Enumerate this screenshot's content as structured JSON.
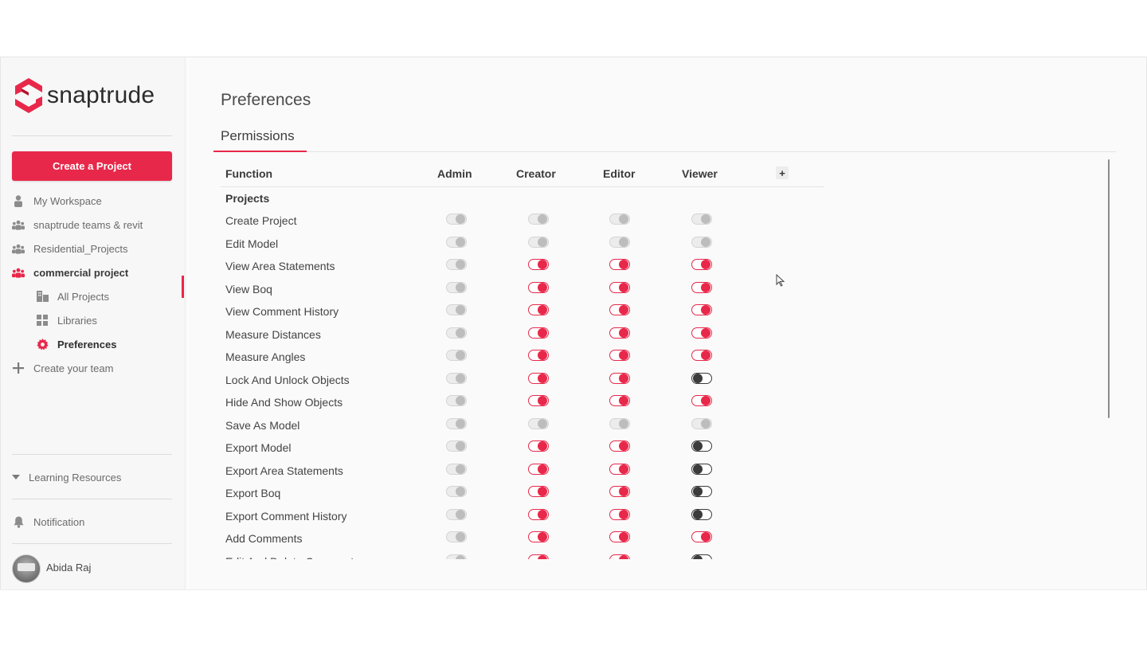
{
  "brand": {
    "name": "snaptrude",
    "accent": "#e8284a"
  },
  "sidebar": {
    "create_button": "Create a Project",
    "items": [
      {
        "label": "My Workspace",
        "icon": "person-icon"
      },
      {
        "label": "snaptrude teams & revit",
        "icon": "team-icon"
      },
      {
        "label": "Residential_Projects",
        "icon": "team-icon"
      },
      {
        "label": "commercial project",
        "icon": "team-icon"
      },
      {
        "label": "All Projects",
        "icon": "buildings-icon"
      },
      {
        "label": "Libraries",
        "icon": "grid-icon"
      },
      {
        "label": "Preferences",
        "icon": "gear-icon"
      },
      {
        "label": "Create your team",
        "icon": "plus-icon"
      }
    ],
    "learning": "Learning Resources",
    "notification": "Notification",
    "user": "Abida Raj"
  },
  "main": {
    "title": "Preferences",
    "tab": "Permissions",
    "columns": [
      "Function",
      "Admin",
      "Creator",
      "Editor",
      "Viewer"
    ],
    "add_column": "+",
    "section": "Projects",
    "rows": [
      {
        "name": "Create Project",
        "states": [
          "off-disabled",
          "off-disabled",
          "off-disabled",
          "off-disabled"
        ]
      },
      {
        "name": "Edit Model",
        "states": [
          "off-disabled",
          "off-disabled",
          "off-disabled",
          "off-disabled"
        ]
      },
      {
        "name": "View Area Statements",
        "states": [
          "off-disabled",
          "on-red",
          "on-red",
          "on-red"
        ]
      },
      {
        "name": "View Boq",
        "states": [
          "off-disabled",
          "on-red",
          "on-red",
          "on-red"
        ]
      },
      {
        "name": "View Comment History",
        "states": [
          "off-disabled",
          "on-red",
          "on-red",
          "on-red"
        ]
      },
      {
        "name": "Measure Distances",
        "states": [
          "off-disabled",
          "on-red",
          "on-red",
          "on-red"
        ]
      },
      {
        "name": "Measure Angles",
        "states": [
          "off-disabled",
          "on-red",
          "on-red",
          "on-red"
        ]
      },
      {
        "name": "Lock And Unlock Objects",
        "states": [
          "off-disabled",
          "on-red",
          "on-red",
          "on-dark"
        ]
      },
      {
        "name": "Hide And Show Objects",
        "states": [
          "off-disabled",
          "on-red",
          "on-red",
          "on-red"
        ]
      },
      {
        "name": "Save As Model",
        "states": [
          "off-disabled",
          "off-disabled",
          "off-disabled",
          "off-disabled"
        ]
      },
      {
        "name": "Export Model",
        "states": [
          "off-disabled",
          "on-red",
          "on-red",
          "on-dark"
        ]
      },
      {
        "name": "Export Area Statements",
        "states": [
          "off-disabled",
          "on-red",
          "on-red",
          "on-dark"
        ]
      },
      {
        "name": "Export Boq",
        "states": [
          "off-disabled",
          "on-red",
          "on-red",
          "on-dark"
        ]
      },
      {
        "name": "Export Comment History",
        "states": [
          "off-disabled",
          "on-red",
          "on-red",
          "on-dark"
        ]
      },
      {
        "name": "Add Comments",
        "states": [
          "off-disabled",
          "on-red",
          "on-red",
          "on-red"
        ]
      },
      {
        "name": "Edit And Delete Comments",
        "states": [
          "off-disabled",
          "on-red",
          "on-red",
          "on-dark"
        ]
      }
    ]
  }
}
